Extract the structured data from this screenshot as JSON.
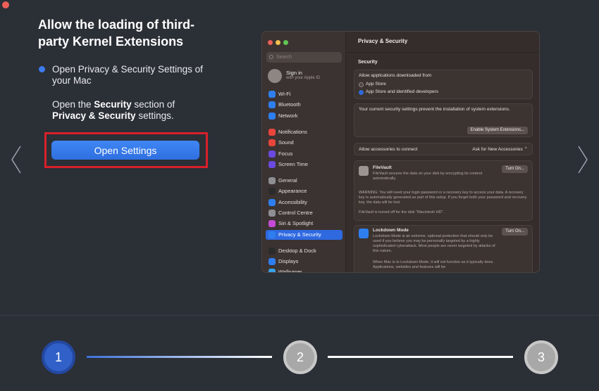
{
  "heading": "Allow the loading of third-party Kernel Extensions",
  "step_text": "Open Privacy & Security Settings of your Mac",
  "description": {
    "prefix": "Open the ",
    "bold1": "Security",
    "middle": " section of ",
    "bold2": "Privacy & Security",
    "suffix": " settings."
  },
  "open_button": "Open Settings",
  "mac": {
    "search_placeholder": "Search",
    "signin_title": "Sign in",
    "signin_sub": "with your Apple ID",
    "sidebar": [
      {
        "label": "Wi-Fi",
        "color": "#2f7ef0"
      },
      {
        "label": "Bluetooth",
        "color": "#2f7ef0"
      },
      {
        "label": "Network",
        "color": "#2f7ef0"
      },
      {
        "label": "Notifications",
        "color": "#e8453c"
      },
      {
        "label": "Sound",
        "color": "#e8453c"
      },
      {
        "label": "Focus",
        "color": "#6a4ae0"
      },
      {
        "label": "Screen Time",
        "color": "#6a4ae0"
      },
      {
        "label": "General",
        "color": "#8e8e93"
      },
      {
        "label": "Appearance",
        "color": "#2b2b2b"
      },
      {
        "label": "Accessibility",
        "color": "#2f7ef0"
      },
      {
        "label": "Control Centre",
        "color": "#8e8e93"
      },
      {
        "label": "Siri & Spotlight",
        "color": "#c64ad8"
      },
      {
        "label": "Privacy & Security",
        "color": "#2f7ef0"
      },
      {
        "label": "Desktop & Dock",
        "color": "#2b2b2b"
      },
      {
        "label": "Displays",
        "color": "#2f7ef0"
      },
      {
        "label": "Wallpaper",
        "color": "#3aa0e8"
      }
    ],
    "title": "Privacy & Security",
    "security_heading": "Security",
    "allow_apps_label": "Allow applications downloaded from",
    "option_app_store": "App Store",
    "option_app_store_dev": "App Store and identified developers",
    "security_warning": "Your current security settings prevent the installation of system extensions.",
    "enable_ext_button": "Enable System Extensions...",
    "accessories_label": "Allow accessories to connect",
    "accessories_value": "Ask for New Accessories",
    "filevault_title": "FileVault",
    "filevault_desc": "FileVault secures the data on your disk by encrypting its content automatically.",
    "turn_on": "Turn On...",
    "filevault_warning": "WARNING: You will need your login password or a recovery key to access your data. A recovery key is automatically generated as part of this setup. If you forget both your password and recovery key, the data will be lost.",
    "filevault_status": "FileVault is turned off for the disk \"Macintosh HD\".",
    "lockdown_title": "Lockdown Mode",
    "lockdown_desc": "Lockdown Mode is an extreme, optional protection that should only be used if you believe you may be personally targeted by a highly sophisticated cyberattack. Most people are never targeted by attacks of this nature.",
    "lockdown_more": "When Mac is in Lockdown Mode, it will not function as it typically does. Applications, websites and features will be"
  },
  "steps": [
    "1",
    "2",
    "3"
  ],
  "colors": {
    "accent": "#3d7bf0",
    "highlight": "#d8202a",
    "active_step": "#3060c8"
  }
}
